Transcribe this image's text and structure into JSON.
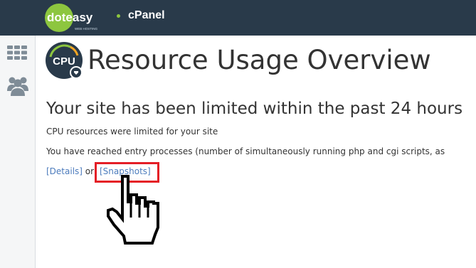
{
  "header": {
    "logo_text": "doteasy",
    "logo_tagline": "WEB HOSTING",
    "product": "cPanel"
  },
  "sidebar": {
    "items": [
      {
        "icon": "grid-icon"
      },
      {
        "icon": "users-icon"
      }
    ]
  },
  "page": {
    "icon_label": "CPU",
    "title": "Resource Usage Overview",
    "subheading": "Your site has been limited within the past 24 hours",
    "line1": "CPU resources were limited for your site",
    "line2": "You have reached entry processes (number of simultaneously running php and cgi scripts, as",
    "details_link": "[Details]",
    "or_text": "or",
    "snapshots_link": "[Snapshots]"
  },
  "colors": {
    "topbar": "#293a4a",
    "accent_green": "#8dc63f",
    "link": "#4d7cbd",
    "highlight_box": "#e41e26"
  }
}
